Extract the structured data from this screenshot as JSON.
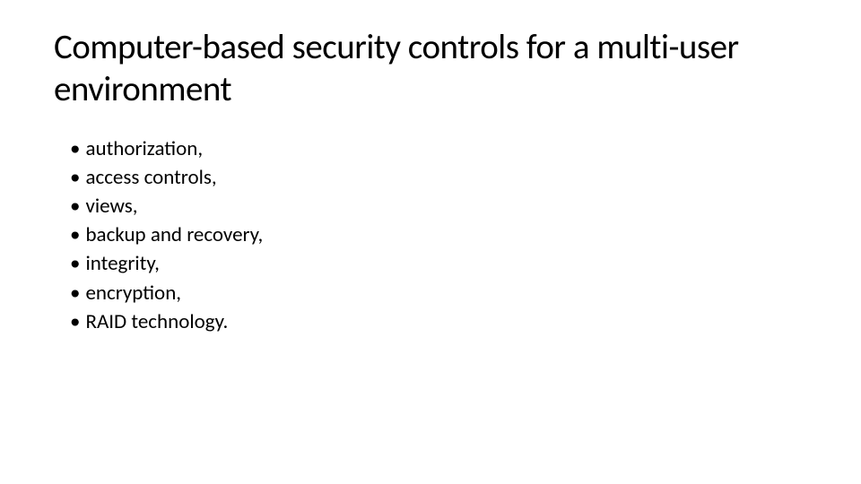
{
  "slide": {
    "title": "Computer-based security controls for a multi-user environment",
    "bullets": [
      "authorization,",
      "access controls,",
      "views,",
      "backup and recovery,",
      "integrity,",
      "encryption,",
      "RAID technology."
    ]
  }
}
